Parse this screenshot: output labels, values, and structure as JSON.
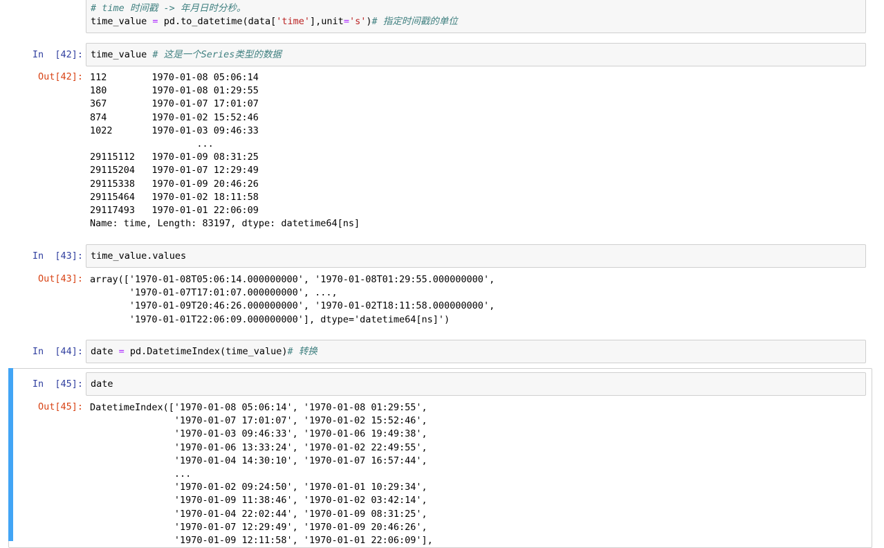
{
  "cells": {
    "c41": {
      "line1_comment": "# time 时间戳 -> 年月日时分秒。",
      "line2": {
        "var": "time_value",
        "eq": "=",
        "call": "pd.to_datetime(data[",
        "key": "'time'",
        "mid": "],unit",
        "eq2": "=",
        "unit": "'s'",
        "close": ")",
        "comment": "# 指定时间戳的单位"
      }
    },
    "c42": {
      "in_prompt": "In  [42]:",
      "code": "time_value ",
      "comment": "# 这是一个Series类型的数据",
      "out_prompt": "Out[42]:",
      "output": [
        "112        1970-01-08 05:06:14",
        "180        1970-01-08 01:29:55",
        "367        1970-01-07 17:01:07",
        "874        1970-01-02 15:52:46",
        "1022       1970-01-03 09:46:33",
        "                   ...         ",
        "29115112   1970-01-09 08:31:25",
        "29115204   1970-01-07 12:29:49",
        "29115338   1970-01-09 20:46:26",
        "29115464   1970-01-02 18:11:58",
        "29117493   1970-01-01 22:06:09",
        "Name: time, Length: 83197, dtype: datetime64[ns]"
      ]
    },
    "c43": {
      "in_prompt": "In  [43]:",
      "code": "time_value.values",
      "out_prompt": "Out[43]:",
      "output": [
        "array(['1970-01-08T05:06:14.000000000', '1970-01-08T01:29:55.000000000',",
        "       '1970-01-07T17:01:07.000000000', ...,",
        "       '1970-01-09T20:46:26.000000000', '1970-01-02T18:11:58.000000000',",
        "       '1970-01-01T22:06:09.000000000'], dtype='datetime64[ns]')"
      ]
    },
    "c44": {
      "in_prompt": "In  [44]:",
      "code_a": "date ",
      "code_eq": "=",
      "code_b": " pd.DatetimeIndex(time_value)",
      "comment": "# 转换"
    },
    "c45": {
      "in_prompt": "In  [45]:",
      "code": "date",
      "out_prompt": "Out[45]:",
      "output": [
        "DatetimeIndex(['1970-01-08 05:06:14', '1970-01-08 01:29:55',",
        "               '1970-01-07 17:01:07', '1970-01-02 15:52:46',",
        "               '1970-01-03 09:46:33', '1970-01-06 19:49:38',",
        "               '1970-01-06 13:33:24', '1970-01-02 22:49:55',",
        "               '1970-01-04 14:30:10', '1970-01-07 16:57:44',",
        "               ...",
        "               '1970-01-02 09:24:50', '1970-01-01 10:29:34',",
        "               '1970-01-09 11:38:46', '1970-01-02 03:42:14',",
        "               '1970-01-04 22:02:44', '1970-01-09 08:31:25',",
        "               '1970-01-07 12:29:49', '1970-01-09 20:46:26',",
        "               '1970-01-09 12:11:58', '1970-01-01 22:06:09'],"
      ]
    }
  },
  "colors": {
    "in_prompt": "#303f9f",
    "out_prompt": "#d84315",
    "comment": "#408080",
    "operator": "#aa22ff",
    "string": "#ba2121",
    "active_bar": "#42a5f5"
  }
}
